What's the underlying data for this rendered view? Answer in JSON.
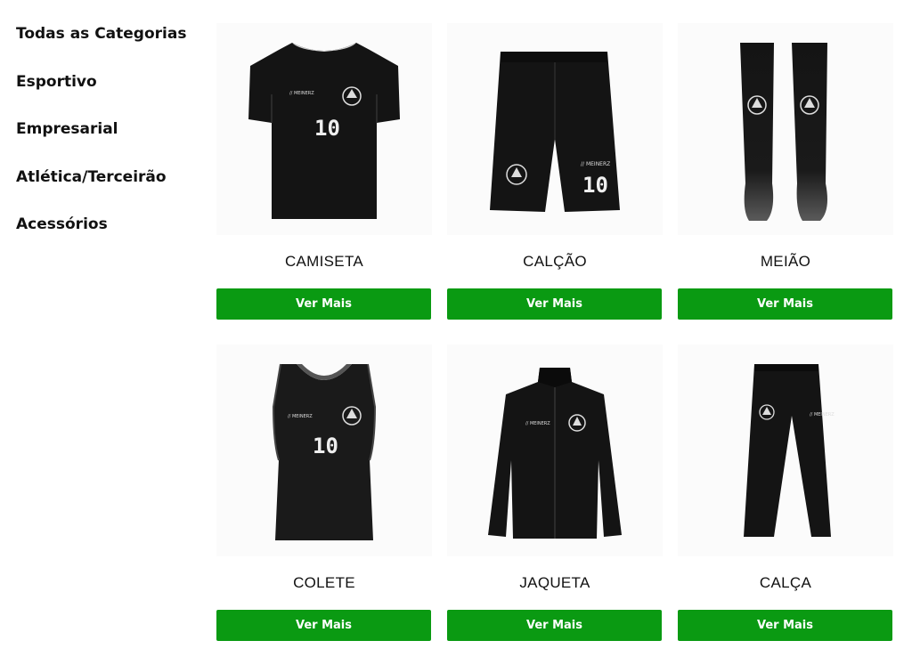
{
  "categories": [
    {
      "label": "Todas as Categorias"
    },
    {
      "label": "Esportivo"
    },
    {
      "label": "Empresarial"
    },
    {
      "label": "Atlética/Terceirão"
    },
    {
      "label": "Acessórios"
    }
  ],
  "products": [
    {
      "name": "CAMISETA",
      "button": "Ver Mais",
      "icon": "jersey-icon"
    },
    {
      "name": "CALÇÃO",
      "button": "Ver Mais",
      "icon": "shorts-icon"
    },
    {
      "name": "MEIÃO",
      "button": "Ver Mais",
      "icon": "socks-icon"
    },
    {
      "name": "COLETE",
      "button": "Ver Mais",
      "icon": "vest-icon"
    },
    {
      "name": "JAQUETA",
      "button": "Ver Mais",
      "icon": "jacket-icon"
    },
    {
      "name": "CALÇA",
      "button": "Ver Mais",
      "icon": "pants-icon"
    }
  ],
  "colors": {
    "button": "#0a9a12",
    "garment": "#141414"
  }
}
